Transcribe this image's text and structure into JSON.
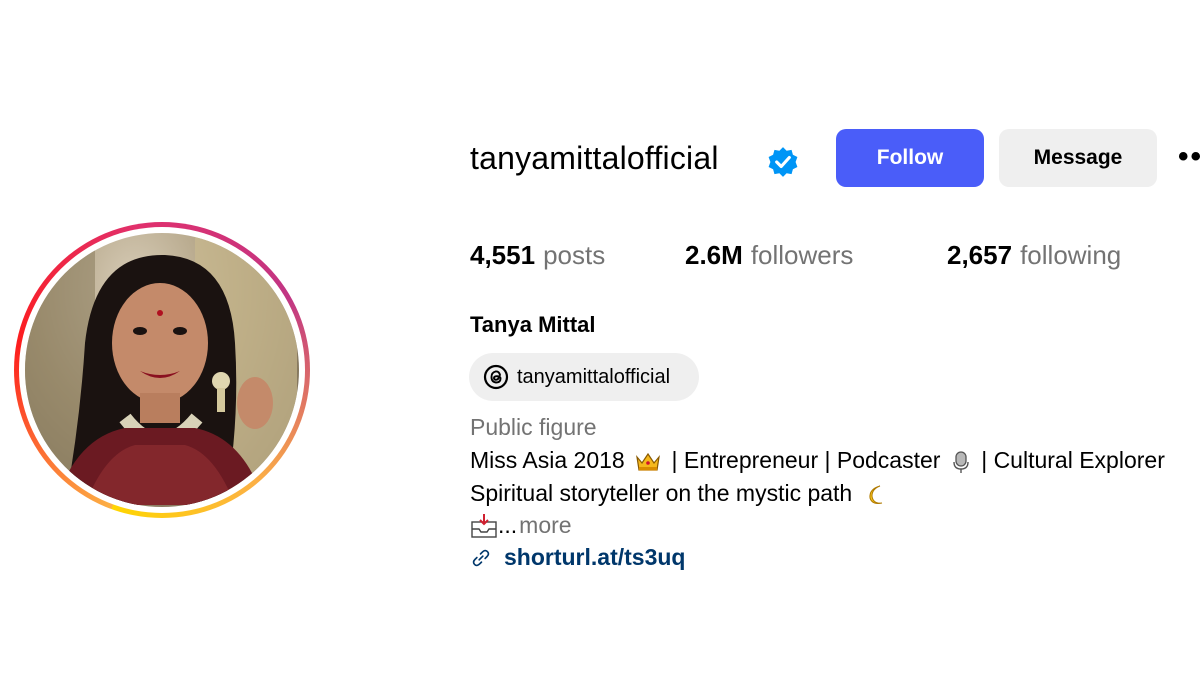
{
  "profile": {
    "username": "tanyamittalofficial",
    "verified": true,
    "follow_label": "Follow",
    "message_label": "Message",
    "more_label": "••",
    "stats": {
      "posts_count": "4,551",
      "posts_label": "posts",
      "followers_count": "2.6M",
      "followers_label": "followers",
      "following_count": "2,657",
      "following_label": "following"
    },
    "full_name": "Tanya Mittal",
    "threads_handle": "tanyamittalofficial",
    "category": "Public figure",
    "bio": {
      "line1_prefix": "Miss Asia 2018",
      "line1_mid": "| Entrepreneur | Podcaster",
      "line1_suffix": "| Cultural Explorer",
      "line2": "Spiritual storyteller on the mystic path",
      "line3_ellipsis": "...",
      "more_label": "more"
    },
    "link": "shorturl.at/ts3uq"
  },
  "colors": {
    "follow_bg": "#4a5df9",
    "message_bg": "#efefef",
    "verified": "#0095f6",
    "muted_text": "#737373",
    "link_text": "#00376b"
  },
  "icons": [
    "verified-badge-icon",
    "more-options-icon",
    "threads-icon",
    "crown-emoji",
    "microphone-emoji",
    "moon-emoji",
    "inbox-emoji",
    "link-icon"
  ]
}
